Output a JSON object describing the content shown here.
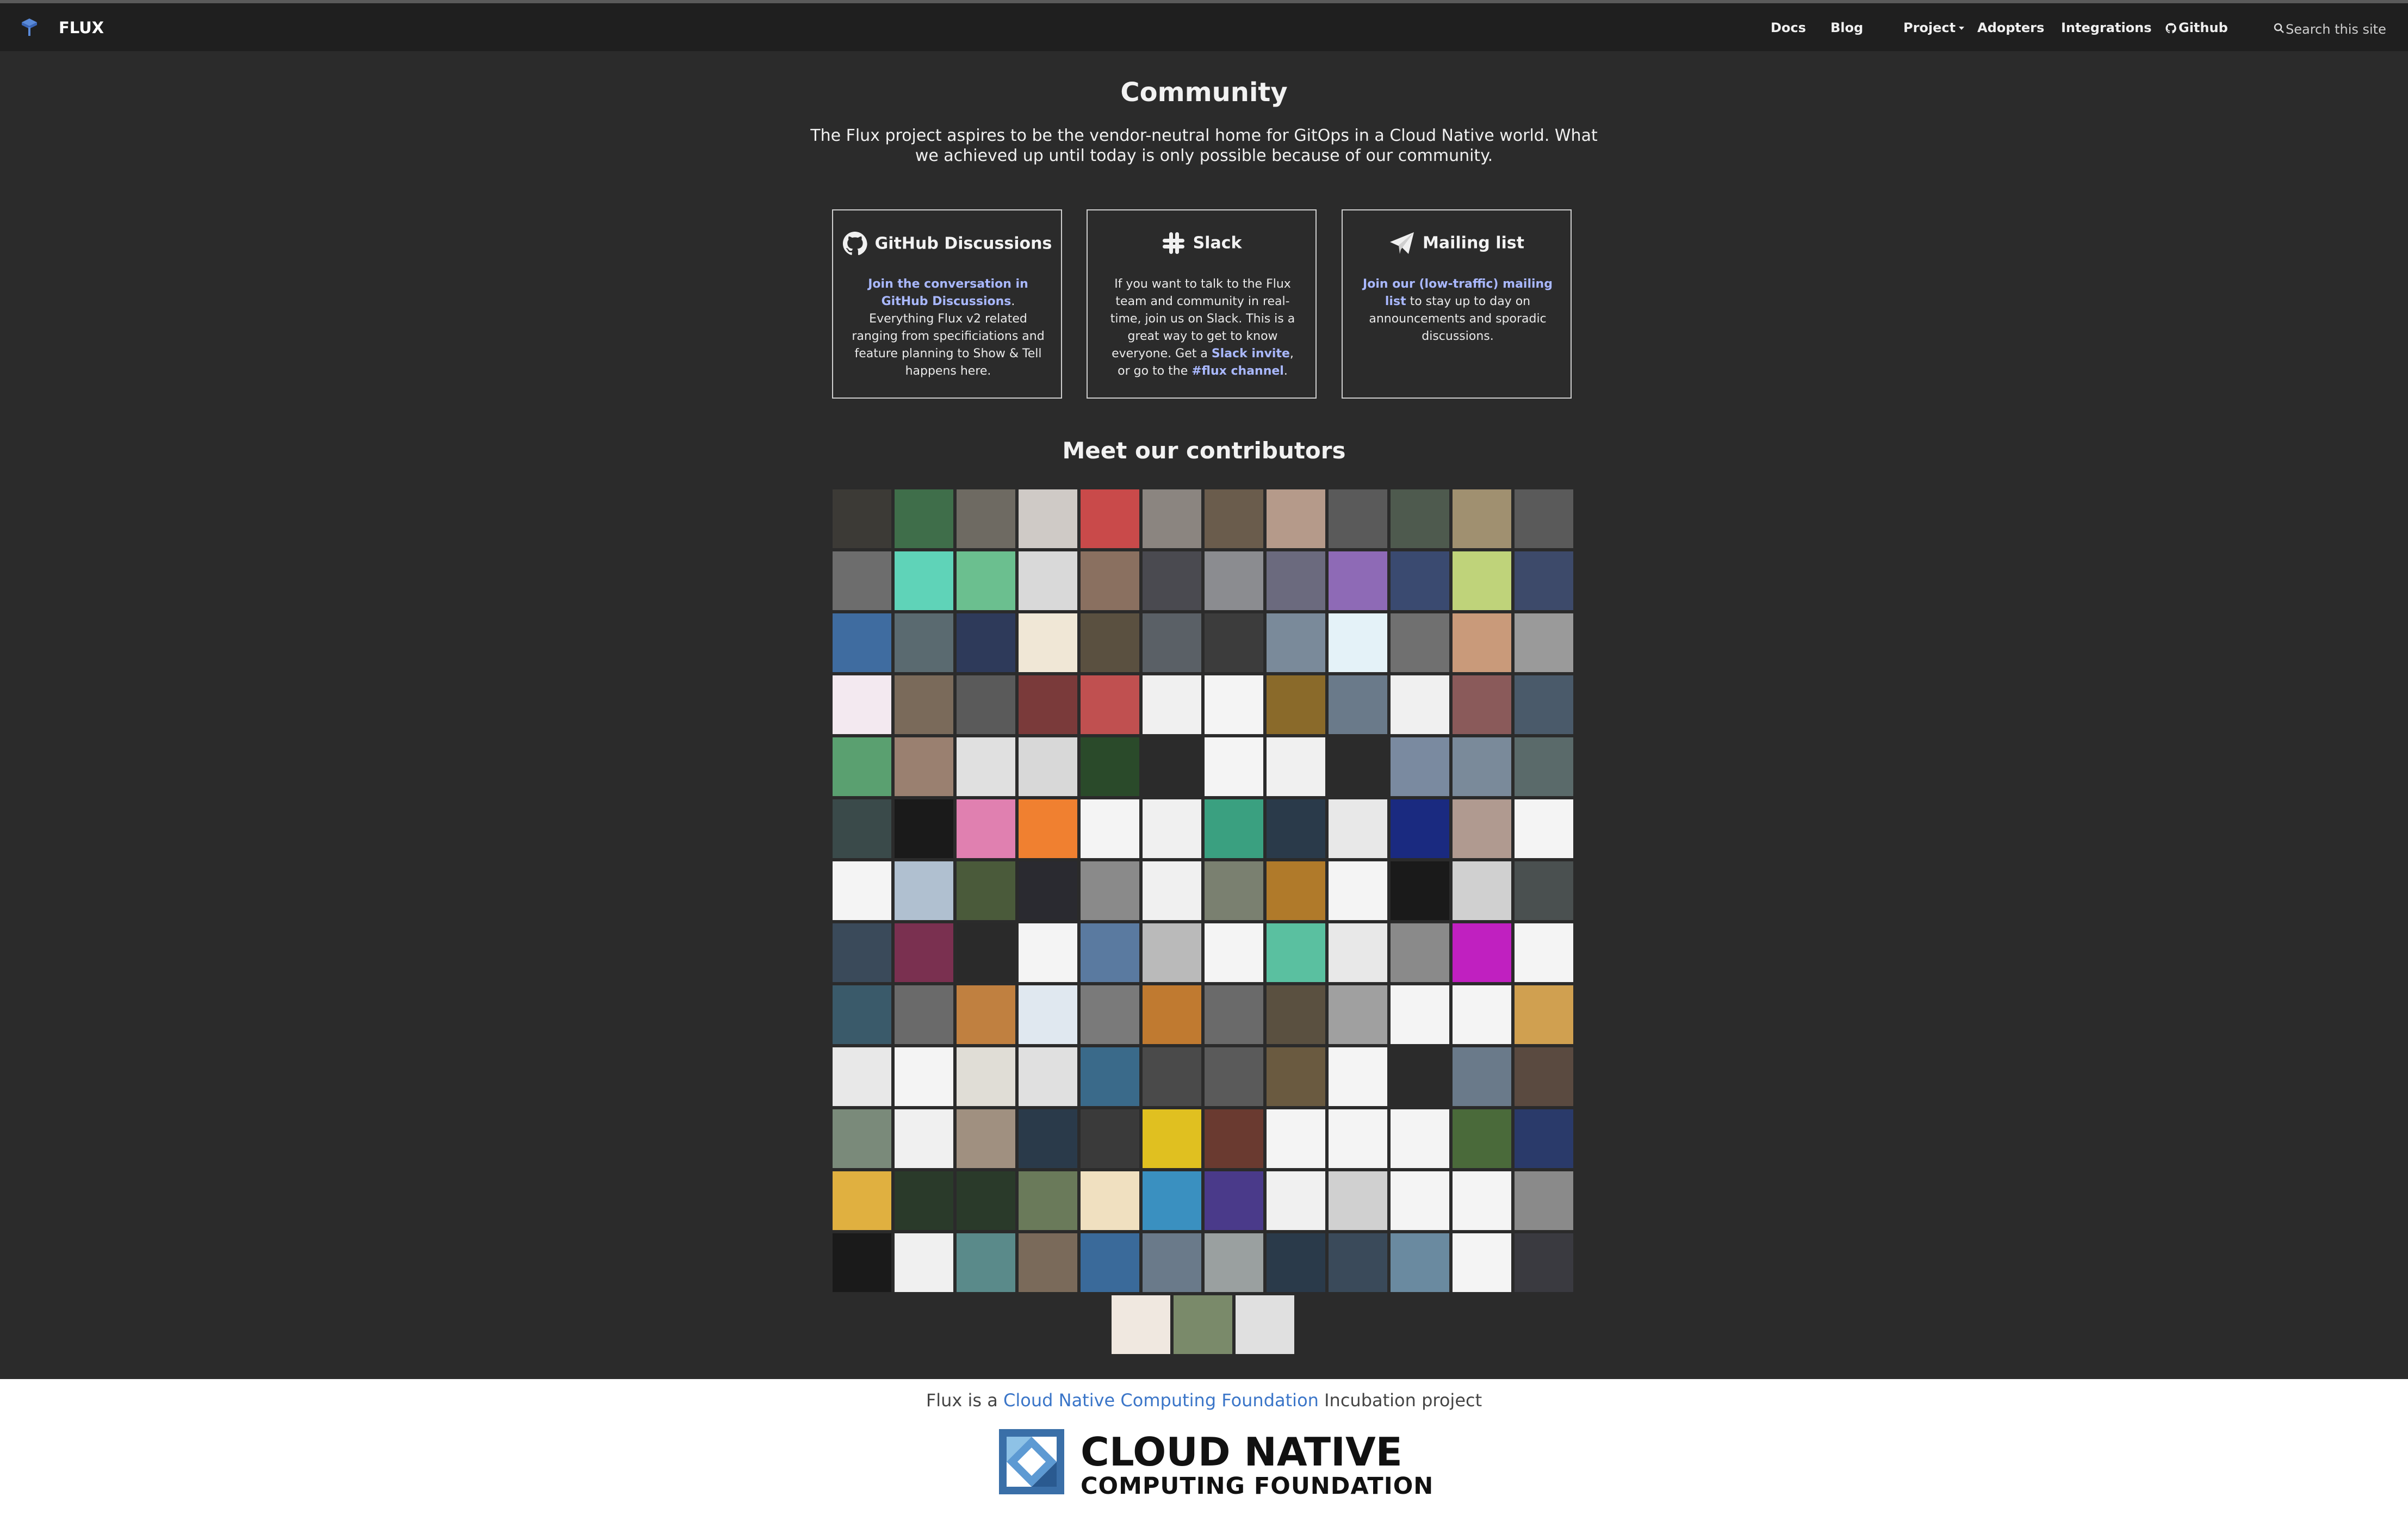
{
  "navbar": {
    "brand": "FLUX",
    "links": {
      "docs": "Docs",
      "blog": "Blog",
      "project": "Project",
      "adopters": "Adopters",
      "integrations": "Integrations",
      "github": "Github"
    },
    "search_placeholder": "Search this site"
  },
  "community": {
    "title": "Community",
    "intro": "The Flux project aspires to be the vendor-neutral home for GitOps in a Cloud Native world. What we achieved up until today is only possible because of our community.",
    "cards": {
      "github": {
        "title": "GitHub Discussions",
        "link": "Join the conversation in GitHub Discussions",
        "text": ". Everything Flux v2 related ranging from specificiations and feature planning to Show & Tell happens here."
      },
      "slack": {
        "title": "Slack",
        "text1": "If you want to talk to the Flux team and community in real-time, join us on Slack. This is a great way to get to know everyone. Get a ",
        "link1": "Slack invite",
        "text2": ", or go to the ",
        "link2": "#flux channel",
        "text3": "."
      },
      "mailing": {
        "title": "Mailing list",
        "link": "Join our (low-traffic) mailing list",
        "text": " to stay up to day on announcements and sporadic discussions."
      }
    }
  },
  "contributors": {
    "title": "Meet our contributors",
    "rows": [
      [
        "#3c3a36",
        "#3f6e4a",
        "#6e6a62",
        "#cfcac6",
        "#c94a4a",
        "#8b8580",
        "#6a5c4c",
        "#b59a8a",
        "#5a5a5a",
        "#4e5a4e",
        "#a09070",
        "#5a5a5a"
      ],
      [
        "#6d6d6d",
        "#5fd3b8",
        "#6bbf8f",
        "#d9d9d9",
        "#8a7060",
        "#4a4a50",
        "#8b8c90",
        "#6b6a7e",
        "#8e6ab6",
        "#3a4a70",
        "#bfd37a",
        "#3d4a6a"
      ],
      [
        "#3f6ca0",
        "#5a6a70",
        "#2e3a5a",
        "#f0e7d6",
        "#5a5040",
        "#5a6066",
        "#3c3c3c",
        "#7a8a9a",
        "#e4f2f8",
        "#707070",
        "#c99a7a",
        "#9a9a9a"
      ],
      [
        "#f3e9f0",
        "#7a6a5a",
        "#5a5a5a",
        "#7a3a3a",
        "#c05050",
        "#f0f0f0",
        "#f4f4f4",
        "#8a6a2a",
        "#6a7a8a",
        "#f0f0f0",
        "#8a5a5a",
        "#4a5a6a"
      ],
      [
        "#5aa070",
        "#9a8070",
        "#e0e0e0",
        "#d8d8d8",
        "#2a4a2a",
        "#2b2b2b",
        "#f4f4f4",
        "#f0f0f0",
        "#2b2b2b",
        "#7a8aa0",
        "#7a8a9a",
        "#5a6a6a"
      ],
      [
        "#3a4a4a",
        "#1a1a1a",
        "#e080b0",
        "#f08030",
        "#f4f4f4",
        "#f0f0f0",
        "#3aa080",
        "#2a3a4a",
        "#e8e8e8",
        "#1a2a80",
        "#b09a90",
        "#f4f4f4"
      ],
      [
        "#f4f4f4",
        "#b0c0d0",
        "#4a5a3a",
        "#2a2a30",
        "#8a8a8a",
        "#f0f0f0",
        "#7a8070",
        "#b07a2a",
        "#f4f4f4",
        "#1a1a1a",
        "#d0d0d0",
        "#4a5050"
      ],
      [
        "#3a4a5a",
        "#7a3050",
        "#2a2a2a",
        "#f4f4f4",
        "#5a7aa0",
        "#bababa",
        "#f4f4f4",
        "#5ac0a0",
        "#e8e8e8",
        "#8a8a8a",
        "#c020c0",
        "#f4f4f4"
      ],
      [
        "#3a5a6a",
        "#6a6a6a",
        "#c08040",
        "#e0e8f0",
        "#7a7a7a",
        "#c07a30",
        "#6a6a6a",
        "#5a5040",
        "#a0a0a0",
        "#f4f4f4",
        "#f4f4f4",
        "#d0a050"
      ],
      [
        "#e8e8e8",
        "#f4f4f4",
        "#e0ddd6",
        "#e0e0e0",
        "#3a6a8a",
        "#4a4a4a",
        "#5a5a5a",
        "#6a5a40",
        "#f4f4f4",
        "#2b2b2b",
        "#6a7a8a",
        "#5a4a40"
      ],
      [
        "#7a8a7a",
        "#f0f0f0",
        "#a09080",
        "#2a3a4a",
        "#3a3a3a",
        "#e0c020",
        "#6a3a30",
        "#f4f4f4",
        "#f4f4f4",
        "#f4f4f4",
        "#4a6a3a",
        "#2a3a6a"
      ],
      [
        "#e0b040",
        "#2a3a2a",
        "#2a3a2a",
        "#6a7a5a",
        "#f0e0c0",
        "#3a90c0",
        "#4a3a8a",
        "#f0f0f0",
        "#d0d0d0",
        "#f4f4f4",
        "#f4f4f4",
        "#8a8a8a"
      ],
      [
        "#1a1a1a",
        "#f0f0f0",
        "#5a8a8a",
        "#7a6a5a",
        "#3a6a9a",
        "#6a7a8a",
        "#9aa0a0",
        "#2a3a4a",
        "#3a4a5a",
        "#6a8aa0",
        "#f4f4f4",
        "#3a3a40"
      ],
      [
        "#f0e8e0",
        "#7a8a6a",
        "#e0e0e0"
      ]
    ]
  },
  "footer": {
    "text_before": "Flux is a ",
    "link": "Cloud Native Computing Foundation",
    "text_after": " Incubation project",
    "cncf_line1": "CLOUD NATIVE",
    "cncf_line2": "COMPUTING FOUNDATION"
  }
}
